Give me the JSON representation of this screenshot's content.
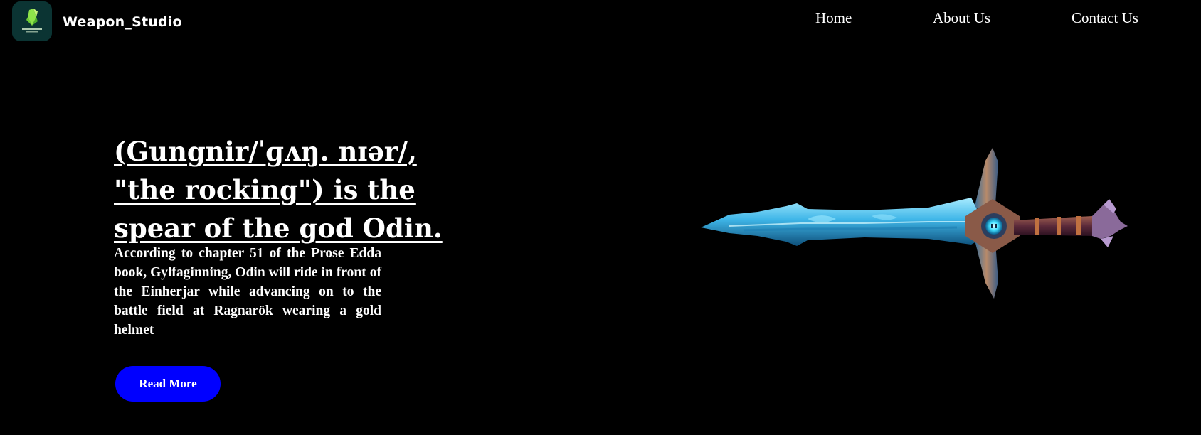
{
  "header": {
    "brand": "Weapon_Studio",
    "logo_icon": "crystal-logo-icon",
    "nav": [
      {
        "label": "Home"
      },
      {
        "label": "About Us"
      },
      {
        "label": "Contact Us"
      }
    ]
  },
  "hero": {
    "title": "(Gungnir/ˈɡʌŋ. nɪər/, \"the rocking\") is the spear of the god Odin.",
    "description": "According to chapter 51 of the Prose Edda book, Gylfaginning, Odin will ride in front of the Einherjar while advancing on to the battle field at Ragnarök wearing a gold helmet",
    "button_label": "Read More",
    "image_icon": "sword-image"
  },
  "colors": {
    "background": "#000000",
    "button": "#0000ff",
    "logo_bg": "#0b3433",
    "text": "#ffffff",
    "blade": "#5cc8f0",
    "hilt": "#7a3a2a"
  }
}
